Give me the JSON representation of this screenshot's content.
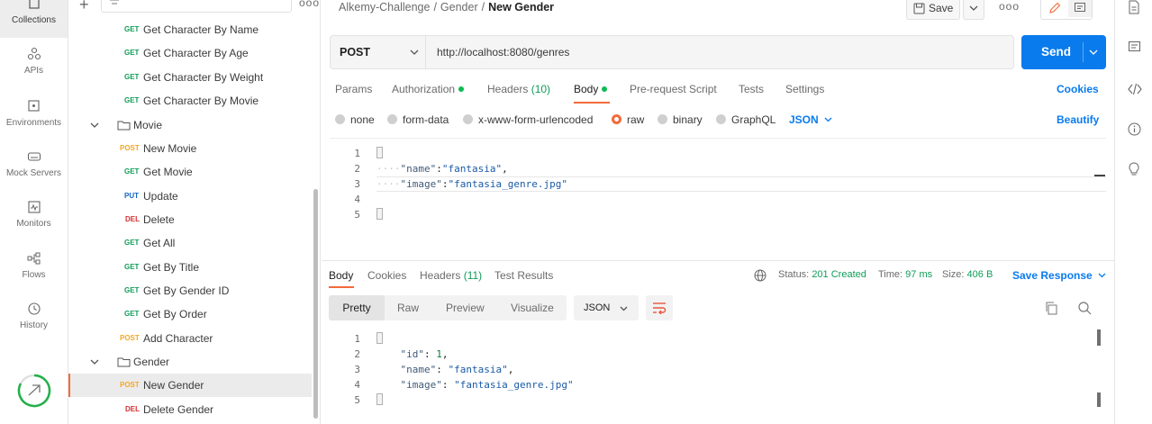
{
  "rail": {
    "items": [
      {
        "label": "Collections",
        "icon": "collections-icon"
      },
      {
        "label": "APIs",
        "icon": "apis-icon"
      },
      {
        "label": "Environments",
        "icon": "environments-icon"
      },
      {
        "label": "Mock Servers",
        "icon": "mock-servers-icon"
      },
      {
        "label": "Monitors",
        "icon": "monitors-icon"
      },
      {
        "label": "Flows",
        "icon": "flows-icon"
      },
      {
        "label": "History",
        "icon": "history-icon"
      }
    ]
  },
  "tree": {
    "requests_top": [
      {
        "method": "GET",
        "name": "Get Character By Name"
      },
      {
        "method": "GET",
        "name": "Get Character By Age"
      },
      {
        "method": "GET",
        "name": "Get Character By Weight"
      },
      {
        "method": "GET",
        "name": "Get Character By Movie"
      }
    ],
    "folder_movie": "Movie",
    "movie_requests": [
      {
        "method": "POST",
        "name": "New Movie"
      },
      {
        "method": "GET",
        "name": "Get Movie"
      },
      {
        "method": "PUT",
        "name": "Update"
      },
      {
        "method": "DEL",
        "name": "Delete"
      },
      {
        "method": "GET",
        "name": "Get All"
      },
      {
        "method": "GET",
        "name": "Get By Title"
      },
      {
        "method": "GET",
        "name": "Get By Gender ID"
      },
      {
        "method": "GET",
        "name": "Get By Order"
      },
      {
        "method": "POST",
        "name": "Add Character"
      }
    ],
    "folder_gender": "Gender",
    "gender_requests": [
      {
        "method": "POST",
        "name": "New Gender"
      },
      {
        "method": "DEL",
        "name": "Delete Gender"
      }
    ]
  },
  "header": {
    "crumb1": "Alkemy-Challenge",
    "sep1": "/",
    "crumb2": "Gender",
    "sep2": "/",
    "crumb3": "New Gender",
    "save_label": "Save"
  },
  "request": {
    "method": "POST",
    "url": "http://localhost:8080/genres",
    "send_label": "Send",
    "tabs": {
      "params": "Params",
      "authorization": "Authorization",
      "headers": "Headers",
      "headers_count": "(10)",
      "body": "Body",
      "prerequest": "Pre-request Script",
      "tests": "Tests",
      "settings": "Settings"
    },
    "cookies_label": "Cookies",
    "body_types": {
      "none": "none",
      "form_data": "form-data",
      "urlencoded": "x-www-form-urlencoded",
      "raw": "raw",
      "binary": "binary",
      "graphql": "GraphQL"
    },
    "format": "JSON",
    "beautify_label": "Beautify",
    "body_lines": [
      {
        "n": "1"
      },
      {
        "n": "2",
        "key": "\"name\"",
        "val": "\"fantasia\"",
        "tail": ","
      },
      {
        "n": "3",
        "key": "\"image\"",
        "val": "\"fantasia_genre.jpg\"",
        "tail": ""
      },
      {
        "n": "4"
      },
      {
        "n": "5"
      }
    ]
  },
  "response": {
    "tabs": {
      "body": "Body",
      "cookies": "Cookies",
      "headers": "Headers",
      "headers_count": "(11)",
      "test_results": "Test Results"
    },
    "status_label": "Status:",
    "status_value": "201 Created",
    "time_label": "Time:",
    "time_value": "97 ms",
    "size_label": "Size:",
    "size_value": "406 B",
    "save_response_label": "Save Response",
    "view_tabs": {
      "pretty": "Pretty",
      "raw": "Raw",
      "preview": "Preview",
      "visualize": "Visualize"
    },
    "format": "JSON",
    "lines": [
      {
        "n": "1"
      },
      {
        "n": "2",
        "key": "\"id\"",
        "val": "1",
        "tail": ","
      },
      {
        "n": "3",
        "key": "\"name\"",
        "val": "\"fantasia\"",
        "tail": ","
      },
      {
        "n": "4",
        "key": "\"image\"",
        "val": "\"fantasia_genre.jpg\"",
        "tail": ""
      },
      {
        "n": "5"
      }
    ]
  },
  "colors": {
    "accent": "#f26b3a",
    "send": "#097bed",
    "get": "#0f9d58",
    "post": "#f6a623",
    "put": "#1565c0",
    "del": "#d32f2f"
  }
}
